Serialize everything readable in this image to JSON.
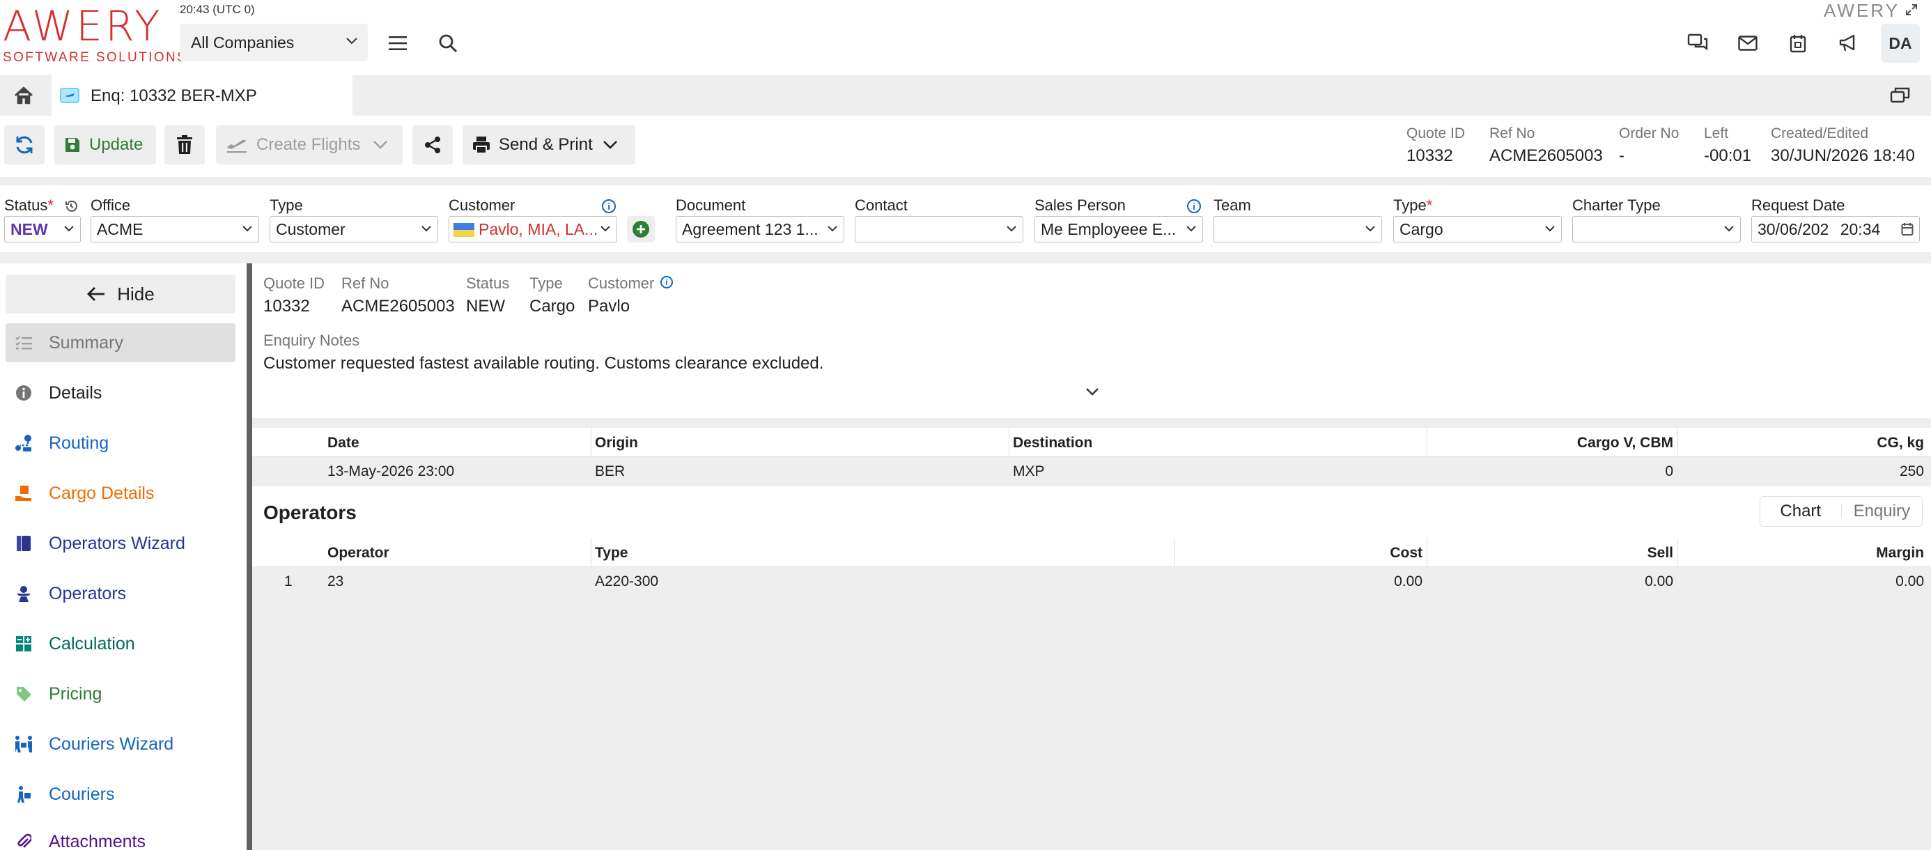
{
  "app": {
    "logo_main": "AWERY",
    "logo_sub": "SOFTWARE SOLUTIONS",
    "brand_right": "AWERY",
    "clock": "20:43 (UTC 0)",
    "company_select": "All Companies",
    "user_initials": "DA",
    "accent_color": "#d32f2f"
  },
  "tab": {
    "title": "Enq: 10332 BER-MXP"
  },
  "toolbar": {
    "update_label": "Update",
    "create_flights_label": "Create Flights",
    "send_print_label": "Send & Print",
    "meta": [
      {
        "key": "Quote ID",
        "value": "10332"
      },
      {
        "key": "Ref No",
        "value": "ACME2605003"
      },
      {
        "key": "Order No",
        "value": "-"
      },
      {
        "key": "Left",
        "value": "-00:01"
      },
      {
        "key": "Created/Edited",
        "value": "30/JUN/2026 18:40"
      }
    ]
  },
  "filters": {
    "status": {
      "label": "Status",
      "value": "NEW"
    },
    "office": {
      "label": "Office",
      "value": "ACME"
    },
    "type": {
      "label": "Type",
      "value": "Customer"
    },
    "customer": {
      "label": "Customer",
      "value": "Pavlo, MIA, LA..."
    },
    "document": {
      "label": "Document",
      "value": "Agreement 123 1..."
    },
    "contact": {
      "label": "Contact",
      "value": ""
    },
    "sales_person": {
      "label": "Sales Person",
      "value": "Me Employeee E..."
    },
    "team": {
      "label": "Team",
      "value": ""
    },
    "cargo_type": {
      "label": "Type",
      "value": "Cargo"
    },
    "charter_type": {
      "label": "Charter Type",
      "value": ""
    },
    "request_date": {
      "label": "Request Date",
      "date": "30/06/202",
      "time": "20:34"
    }
  },
  "sidebar": {
    "hide_label": "Hide",
    "items": [
      {
        "label": "Summary",
        "icon": "summary-list-icon",
        "color": "#757575"
      },
      {
        "label": "Details",
        "icon": "info-icon",
        "color": "#212121"
      },
      {
        "label": "Routing",
        "icon": "routing-icon",
        "color": "#1565c0"
      },
      {
        "label": "Cargo Details",
        "icon": "cargo-icon",
        "color": "#ef6c00"
      },
      {
        "label": "Operators Wizard",
        "icon": "wizard-icon",
        "color": "#283593"
      },
      {
        "label": "Operators",
        "icon": "operators-icon",
        "color": "#283593"
      },
      {
        "label": "Calculation",
        "icon": "calculation-icon",
        "color": "#00695c"
      },
      {
        "label": "Pricing",
        "icon": "tag-icon",
        "color": "#2e7d32"
      },
      {
        "label": "Couriers Wizard",
        "icon": "couriers-wizard-icon",
        "color": "#1565c0"
      },
      {
        "label": "Couriers",
        "icon": "courier-icon",
        "color": "#1565c0"
      },
      {
        "label": "Attachments",
        "icon": "paperclip-icon",
        "color": "#4a148c"
      }
    ]
  },
  "summary": {
    "fields": [
      {
        "key": "Quote ID",
        "value": "10332"
      },
      {
        "key": "Ref No",
        "value": "ACME2605003"
      },
      {
        "key": "Status",
        "value": "NEW"
      },
      {
        "key": "Type",
        "value": "Cargo"
      },
      {
        "key": "Customer",
        "value": "Pavlo"
      }
    ],
    "notes_label": "Enquiry Notes",
    "notes_value": "Customer requested fastest available routing. Customs clearance excluded."
  },
  "routing_table": {
    "headers": [
      "Date",
      "Origin",
      "Destination",
      "Cargo V, CBM",
      "CG, kg"
    ],
    "rows": [
      [
        "13-May-2026 23:00",
        "BER",
        "MXP",
        "0",
        "250"
      ]
    ]
  },
  "operators": {
    "title": "Operators",
    "view_chart": "Chart",
    "view_enquiry": "Enquiry",
    "headers": [
      "Operator",
      "Type",
      "Cost",
      "Sell",
      "Margin"
    ],
    "rows": [
      {
        "num": "1",
        "operator": "23",
        "type": "A220-300",
        "cost": "0.00",
        "sell": "0.00",
        "margin": "0.00"
      }
    ]
  }
}
